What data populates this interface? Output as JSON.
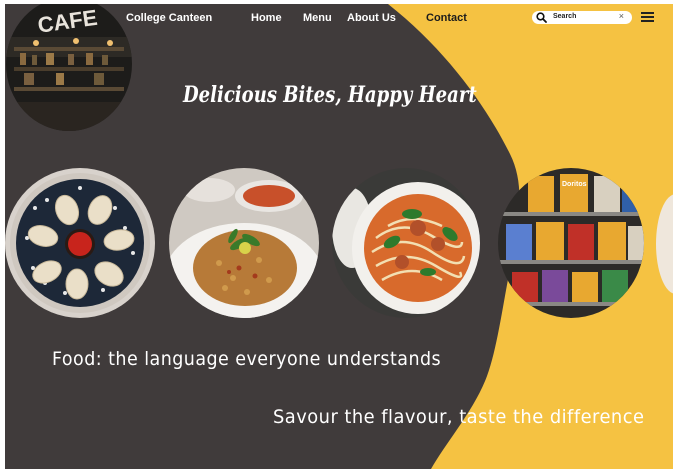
{
  "nav": {
    "brand": "College Canteen",
    "links": [
      "Home",
      "Menu",
      "About Us",
      "Contact"
    ],
    "search_placeholder": "Search"
  },
  "hero": {
    "cafe_sign": "CAFE",
    "headline": "Delicious Bites, Happy Heart"
  },
  "gallery": {
    "items": [
      "momos-photo",
      "fried-rice-photo",
      "noodle-soup-photo",
      "vending-machine-photo"
    ],
    "vending_brand": "Doritos"
  },
  "taglines": {
    "line1": "Food: the language everyone understands",
    "line2": "Savour the flavour, taste the difference"
  },
  "colors": {
    "background": "#403b3b",
    "accent_yellow": "#f5c242",
    "text": "#ffffff"
  }
}
